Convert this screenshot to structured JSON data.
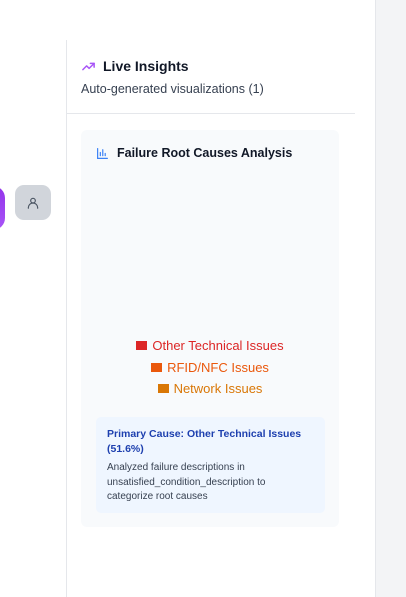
{
  "insights": {
    "title": "Live Insights",
    "subtitle": "Auto-generated visualizations (1)",
    "icons": {
      "header": "trending-up-icon",
      "card": "bar-chart-icon",
      "avatar": "user-icon"
    },
    "colors": {
      "accent": "#a855f7"
    }
  },
  "chart_card": {
    "title": "Failure Root Causes Analysis",
    "legend": [
      {
        "label": "Other Technical Issues",
        "color": "#dc2626"
      },
      {
        "label": "RFID/NFC Issues",
        "color": "#ea580c"
      },
      {
        "label": "Network Issues",
        "color": "#d97706"
      }
    ],
    "summary": {
      "title": "Primary Cause: Other Technical Issues (51.6%)",
      "description": "Analyzed failure descriptions in unsatisfied_condition_description to categorize root causes"
    }
  }
}
